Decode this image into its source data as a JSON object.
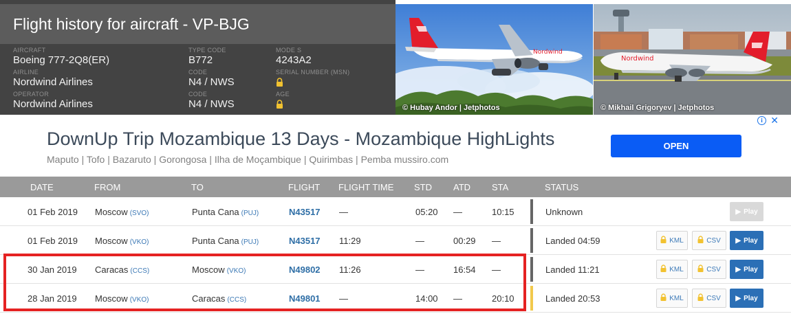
{
  "header": {
    "title": "Flight history for aircraft - VP-BJG",
    "fields": {
      "aircraft": {
        "label": "AIRCRAFT",
        "value": "Boeing 777-2Q8(ER)"
      },
      "type_code": {
        "label": "TYPE CODE",
        "value": "B772"
      },
      "mode_s": {
        "label": "MODE S",
        "value": "4243A2"
      },
      "airline": {
        "label": "AIRLINE",
        "value": "Nordwind Airlines"
      },
      "airline_code": {
        "label": "Code",
        "value": "N4 / NWS"
      },
      "serial": {
        "label": "SERIAL NUMBER (MSN)",
        "value_icon": "lock-icon"
      },
      "operator": {
        "label": "OPERATOR",
        "value": "Nordwind Airlines"
      },
      "operator_code": {
        "label": "Code",
        "value": "N4 / NWS"
      },
      "age": {
        "label": "AGE",
        "value_icon": "lock-icon"
      }
    },
    "photos": [
      {
        "credit": "© Hubay Andor | Jetphotos"
      },
      {
        "credit": "© Mikhail Grigoryev | Jetphotos"
      }
    ]
  },
  "ad": {
    "title": "DownUp Trip Mozambique 13 Days - Mozambique HighLights",
    "subtitle": "Maputo | Tofo | Bazaruto | Gorongosa | Ilha de Moçambique | Quirimbas | Pemba mussiro.com",
    "button_label": "OPEN",
    "info_label": "i",
    "close_label": "✕"
  },
  "table": {
    "columns": [
      "DATE",
      "FROM",
      "TO",
      "FLIGHT",
      "FLIGHT TIME",
      "STD",
      "ATD",
      "STA",
      "STATUS"
    ],
    "rows": [
      {
        "date": "01 Feb 2019",
        "from": "Moscow",
        "from_code": "(SVO)",
        "to": "Punta Cana",
        "to_code": "(PUJ)",
        "flight": "N43517",
        "flight_time": "—",
        "std": "05:20",
        "atd": "—",
        "sta": "10:15",
        "status": "Unknown"
      },
      {
        "date": "01 Feb 2019",
        "from": "Moscow",
        "from_code": "(VKO)",
        "to": "Punta Cana",
        "to_code": "(PUJ)",
        "flight": "N43517",
        "flight_time": "11:29",
        "std": "—",
        "atd": "00:29",
        "sta": "—",
        "status": "Landed 04:59"
      },
      {
        "date": "30 Jan 2019",
        "from": "Caracas",
        "from_code": "(CCS)",
        "to": "Moscow",
        "to_code": "(VKO)",
        "flight": "N49802",
        "flight_time": "11:26",
        "std": "—",
        "atd": "16:54",
        "sta": "—",
        "status": "Landed 11:21"
      },
      {
        "date": "28 Jan 2019",
        "from": "Moscow",
        "from_code": "(VKO)",
        "to": "Caracas",
        "to_code": "(CCS)",
        "flight": "N49801",
        "flight_time": "—",
        "std": "14:00",
        "atd": "—",
        "sta": "20:10",
        "status": "Landed 20:53"
      }
    ],
    "buttons": {
      "kml": "KML",
      "csv": "CSV",
      "play": "Play"
    }
  },
  "colors": {
    "header_dark": "#434343",
    "table_header": "#9a9a9a",
    "link_blue": "#2e6ea6",
    "play_blue": "#2b6fb6",
    "ad_button": "#0a5cf5",
    "highlight_red": "#e52222",
    "status_yellow": "#f2c94c"
  }
}
